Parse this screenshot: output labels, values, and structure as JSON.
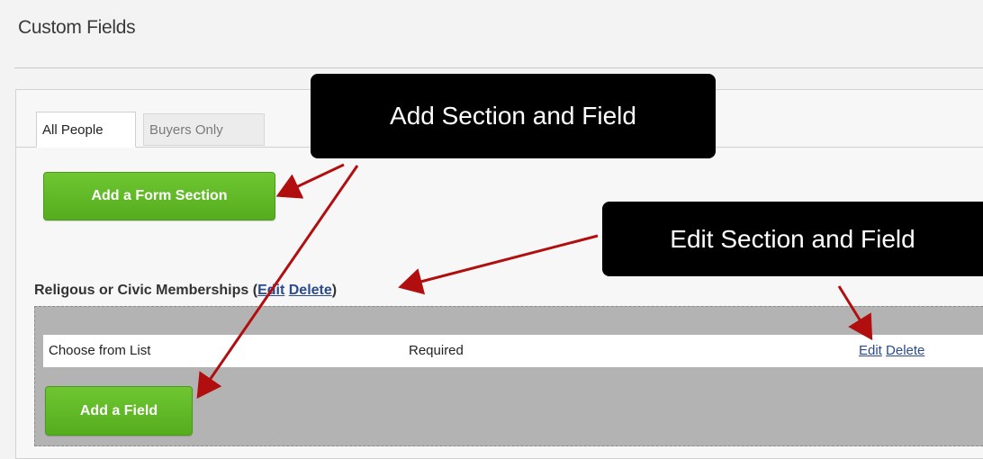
{
  "page": {
    "title": "Custom Fields"
  },
  "tabs": [
    {
      "label": "All People",
      "active": true
    },
    {
      "label": "Buyers Only",
      "active": false
    }
  ],
  "buttons": {
    "add_section": "Add a Form Section",
    "add_field": "Add a Field"
  },
  "section": {
    "name": "Religous or Civic Memberships",
    "open_paren": "(",
    "edit": "Edit",
    "delete": "Delete",
    "close_paren": ")"
  },
  "field_row": {
    "type": "Choose from List",
    "required": "Required",
    "edit": "Edit",
    "delete": "Delete"
  },
  "callouts": {
    "add": "Add Section and Field",
    "edit": "Edit Section and Field"
  },
  "colors": {
    "button_green": "#5cb624",
    "link_blue": "#2b4b8c",
    "arrow_red": "#b10f0f",
    "section_gray": "#b3b3b3"
  }
}
